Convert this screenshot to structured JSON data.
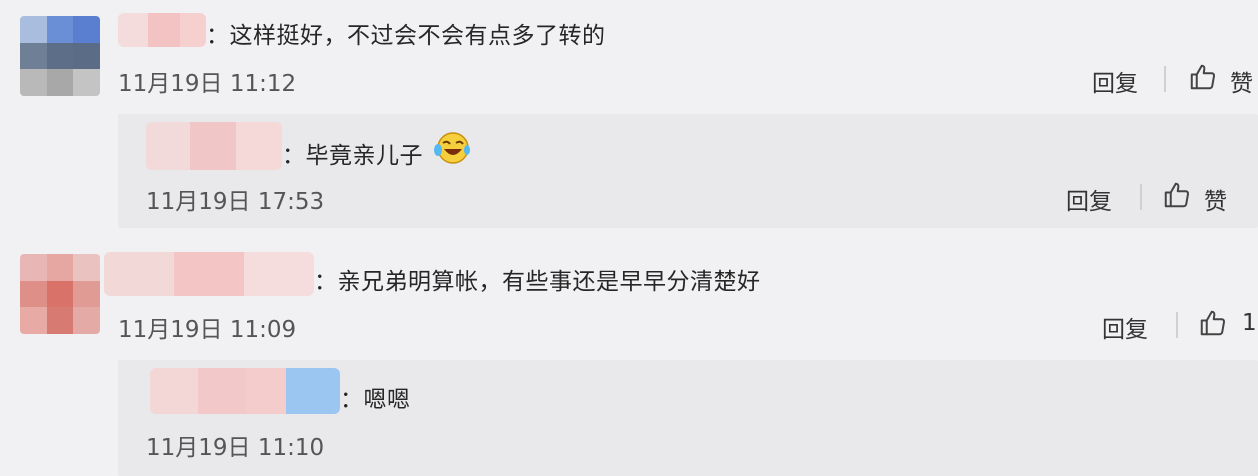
{
  "comments": [
    {
      "text": "：这样挺好，不过会不会有点多了转的",
      "time": "11月19日 11:12",
      "reply_label": "回复",
      "like_label": "赞",
      "reply": {
        "text": "：毕竟亲儿子",
        "emoji": "laughing-tears-emoji",
        "time": "11月19日 17:53",
        "reply_label": "回复",
        "like_label": "赞"
      }
    },
    {
      "text": "：亲兄弟明算帐，有些事还是早早分清楚好",
      "time": "11月19日 11:09",
      "reply_label": "回复",
      "like_label": "1",
      "reply": {
        "text": "：嗯嗯",
        "time": "11月19日 11:10"
      }
    }
  ],
  "colors": {
    "background": "#f1f1f3",
    "reply_panel": "#e9e9ec",
    "text": "#262626",
    "muted": "#555555"
  }
}
